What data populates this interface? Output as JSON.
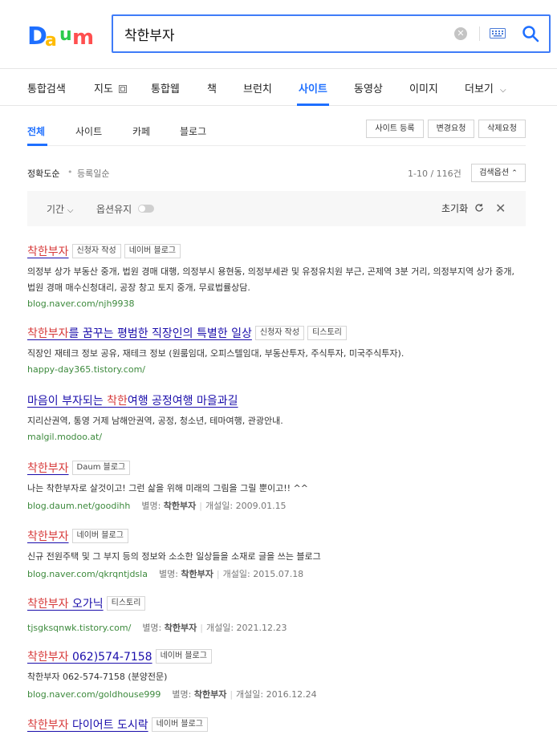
{
  "search": {
    "query": "착한부자",
    "placeholder": ""
  },
  "logo": {
    "letters": [
      "D",
      "a",
      "u",
      "m"
    ]
  },
  "main_tabs": [
    {
      "label": "통합검색"
    },
    {
      "label": "지도"
    },
    {
      "label": "통합웹"
    },
    {
      "label": "책"
    },
    {
      "label": "브런치"
    },
    {
      "label": "사이트",
      "active": true
    },
    {
      "label": "동영상"
    },
    {
      "label": "이미지"
    },
    {
      "label": "더보기"
    }
  ],
  "sub_tabs": [
    {
      "label": "전체",
      "active": true
    },
    {
      "label": "사이트"
    },
    {
      "label": "카페"
    },
    {
      "label": "블로그"
    }
  ],
  "actions": {
    "register": "사이트 등록",
    "change": "변경요청",
    "delete": "삭제요청"
  },
  "sort": {
    "accuracy": "정확도순",
    "date": "등록일순",
    "count": "1-10 / 116건",
    "filter_options": "검색옵션"
  },
  "filter_bar": {
    "period": "기간",
    "keep_options": "옵션유지",
    "reset": "초기화"
  },
  "results": [
    {
      "title_hl": "착한부자",
      "title_rest": "",
      "tags": [
        "신청자 작성",
        "네이버 블로그"
      ],
      "desc": "의정부 상가 부동산 중개, 법원 경매 대행, 의정부시 용현동, 의정부세관 및 유정유치원 부근, 곤제역 3분 거리, 의정부지역 상가 중개, 법원 경매 매수신청대리, 공장 창고 토지 중개, 무료법률상담.",
      "url": "blog.naver.com/njh9938"
    },
    {
      "title_hl": "착한부자",
      "title_rest": "를 꿈꾸는 평범한 직장인의 특별한 일상",
      "tags": [
        "신청자 작성",
        "티스토리"
      ],
      "desc": "직장인 재테크 정보 공유, 재테크 정보 (원룸임대, 오피스텔임대, 부동산투자, 주식투자, 미국주식투자).",
      "url": "happy-day365.tistory.com/"
    },
    {
      "title_pre": "마음이 부자되는 ",
      "title_hl": "착한",
      "title_rest": "여행 공정여행 마을과길",
      "tags": [],
      "desc": "지리산권역, 통영 거제 남해안권역, 공정, 청소년, 테마여행, 관광안내.",
      "url": "malgil.modoo.at/"
    },
    {
      "title_hl": "착한부자",
      "title_rest": "",
      "tags": [
        "Daum 블로그"
      ],
      "desc": "나는 착한부자로 살것이고! 그런 삶을 위해 미래의 그림을 그릴 뿐이고!! ^^",
      "url": "blog.daum.net/goodihh",
      "alias_label": "별명:",
      "alias": "착한부자",
      "opened_label": "개설일:",
      "opened": "2009.01.15"
    },
    {
      "title_hl": "착한부자",
      "title_rest": "",
      "tags": [
        "네이버 블로그"
      ],
      "desc": "신규 전원주택 및 그 부지 등의 정보와 소소한 일상들을 소재로 글을 쓰는 블로그",
      "url": "blog.naver.com/qkrqntjdsla",
      "alias_label": "별명:",
      "alias": "착한부자",
      "opened_label": "개설일:",
      "opened": "2015.07.18"
    },
    {
      "title_hl": "착한부자",
      "title_rest": " 오가닉",
      "tags": [
        "티스토리"
      ],
      "desc": "",
      "url": "tjsgksqnwk.tistory.com/",
      "alias_label": "별명:",
      "alias": "착한부자",
      "opened_label": "개설일:",
      "opened": "2021.12.23"
    },
    {
      "title_hl": "착한부자",
      "title_rest": " 062)574-7158",
      "tags": [
        "네이버 블로그"
      ],
      "desc": "착한부자 062-574-7158 (분양전문)",
      "url": "blog.naver.com/goldhouse999",
      "alias_label": "별명:",
      "alias": "착한부자",
      "opened_label": "개설일:",
      "opened": "2016.12.24"
    },
    {
      "title_hl": "착한부자",
      "title_rest": " 다이어트 도시락",
      "tags": [
        "네이버 블로그"
      ],
      "desc": "",
      "url": ""
    }
  ]
}
